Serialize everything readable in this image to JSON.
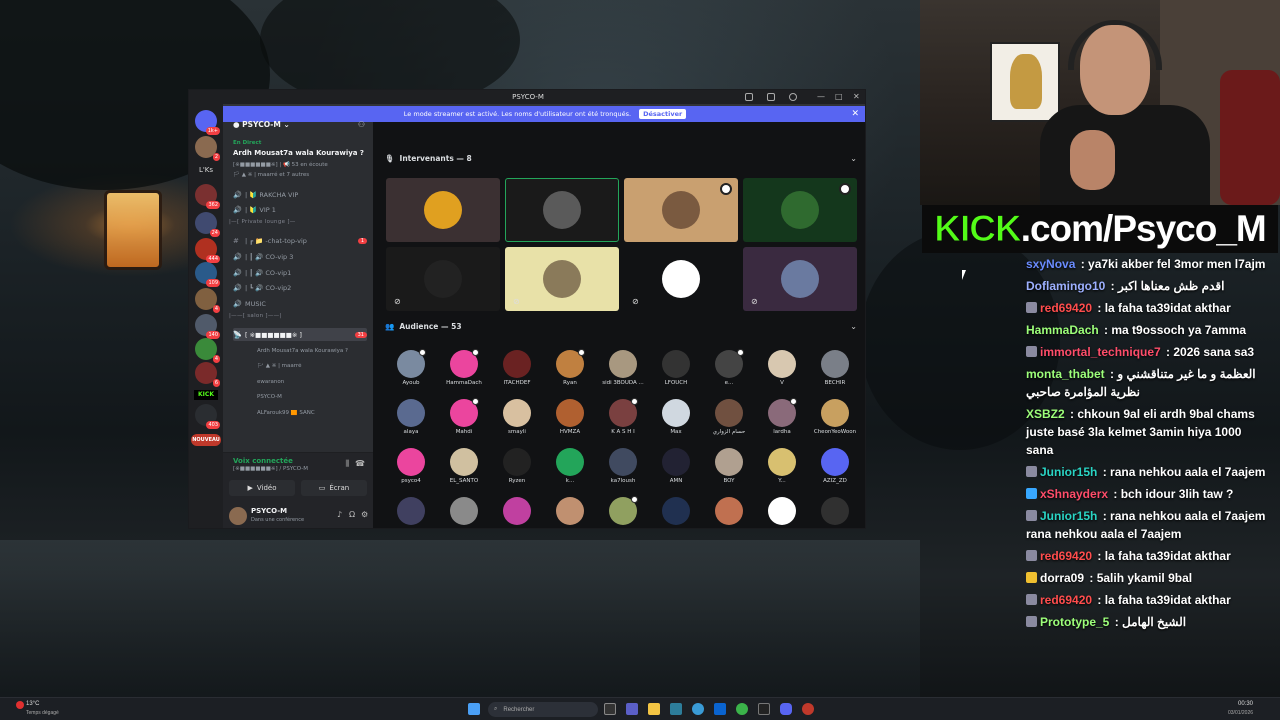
{
  "window": {
    "title": "PSYCO-M"
  },
  "streamer_banner": {
    "text": "Le mode streamer est activé. Les noms d'utilisateur ont été tronqués.",
    "button": "Désactiver"
  },
  "server": {
    "name": "PSYCO-M",
    "live_tag": "En Direct",
    "stage_title": "Ardh Mousat7a wala Kourawiya ?",
    "stage_sub": "[※■■■■■■※] | 📢 53 en écoute",
    "stage_sub2": "🏳 ▲ ※ | maarré et 7 autres"
  },
  "rail": {
    "l_ks": "L'Ks",
    "kick": "KICK",
    "nouveau": "NOUVEAU",
    "badges": [
      "1k+",
      "2",
      "362",
      "24",
      "444",
      "109",
      "4",
      "140",
      "4",
      "6",
      "403"
    ]
  },
  "channels": [
    {
      "icon": "🔊",
      "label": "| 🔰 RAKCHA VIP"
    },
    {
      "icon": "🔊",
      "label": "| 🔰 VIP 1"
    },
    {
      "icon": "cat",
      "label": "|—[ Private lounge ]—"
    },
    {
      "icon": "#",
      "label": "| ┏ 📁 -chat-top-vip",
      "badge": "1"
    },
    {
      "icon": "🔊",
      "label": "| ┃ 🔊 CO-vip 3"
    },
    {
      "icon": "🔊",
      "label": "| ┃ 🔊 CO-vip1"
    },
    {
      "icon": "🔊",
      "label": "| ┗ 🔊 CO-vip2"
    },
    {
      "icon": "🔊",
      "label": "MUSIC"
    },
    {
      "icon": "cat",
      "label": "|——[ salon ]——|"
    },
    {
      "icon": "📡",
      "label": "[ ※■■■■■■※ ]",
      "badge": "31"
    },
    {
      "icon": "",
      "label": "Ardh Mousat7a wala Kourawiya ?"
    },
    {
      "icon": "",
      "label": "🏳 ▲ ※ | maarré"
    },
    {
      "icon": "",
      "label": "ewaranon"
    },
    {
      "icon": "",
      "label": "PSYCO-M"
    },
    {
      "icon": "",
      "label": "ALFarouk99 🟧 SANC"
    }
  ],
  "voice": {
    "status": "Voix connectée",
    "path": "[※■■■■■■※] / PSYCO-M",
    "video": "Vidéo",
    "screen": "Écran"
  },
  "user": {
    "name": "PSYCO-M",
    "status": "Dans une conférence"
  },
  "stage": {
    "speakers_label": "Intervenants — 8",
    "audience_label": "Audience — 53",
    "speakers": [
      {
        "bg": "#3b3032",
        "av": "#e0a020"
      },
      {
        "bg": "#1a1a1a",
        "av": "#5a5a5a"
      },
      {
        "bg": "#c9a070",
        "av": "#7a5a40"
      },
      {
        "bg": "#14371c",
        "av": "#2f6a2f"
      },
      {
        "bg": "#1a1a1a",
        "av": "#222"
      },
      {
        "bg": "#e8e1a8",
        "av": "#8a7a5a"
      },
      {
        "bg": "#111214",
        "av": "#ffffff"
      },
      {
        "bg": "#3a2a40",
        "av": "#6a7aa0"
      }
    ],
    "audience": [
      {
        "name": "Ayoub",
        "c": "#7a8aa0"
      },
      {
        "name": "HammaDach",
        "c": "#eb459e"
      },
      {
        "name": "ITACHDEF",
        "c": "#6a2222"
      },
      {
        "name": "Ryan",
        "c": "#c08040"
      },
      {
        "name": "sidi 3BOUDA ...",
        "c": "#a89880"
      },
      {
        "name": "LFOUCH",
        "c": "#333"
      },
      {
        "name": "e...",
        "c": "#444"
      },
      {
        "name": "V",
        "c": "#d8c8b0"
      },
      {
        "name": "BECHIR",
        "c": "#7a7f88"
      },
      {
        "name": "alaya",
        "c": "#5a6a90"
      },
      {
        "name": "Mahdi",
        "c": "#eb459e"
      },
      {
        "name": "smayli",
        "c": "#d8c0a0"
      },
      {
        "name": "HVMZA",
        "c": "#b06030"
      },
      {
        "name": "K A S H I",
        "c": "#7a4040"
      },
      {
        "name": "Max",
        "c": "#d0d8e0"
      },
      {
        "name": "حسام الزواري",
        "c": "#705040"
      },
      {
        "name": "lardha",
        "c": "#8a6a7a"
      },
      {
        "name": "CheonYeoWoon",
        "c": "#c8a060"
      },
      {
        "name": "psyco4",
        "c": "#eb459e"
      },
      {
        "name": "EL_SANTO",
        "c": "#d0c0a0"
      },
      {
        "name": "Ryzen",
        "c": "#222"
      },
      {
        "name": "k...",
        "c": "#23a55a"
      },
      {
        "name": "ka7loush",
        "c": "#404a60"
      },
      {
        "name": "AMN",
        "c": "#223"
      },
      {
        "name": "BOY",
        "c": "#b0a090"
      },
      {
        "name": "Y...",
        "c": "#d8c070"
      },
      {
        "name": "AZIZ_ZD",
        "c": "#5865f2"
      },
      {
        "name": "",
        "c": "#404060"
      },
      {
        "name": "",
        "c": "#8a8a8a"
      },
      {
        "name": "",
        "c": "#c040a0"
      },
      {
        "name": "",
        "c": "#c09070"
      },
      {
        "name": "",
        "c": "#90a060"
      },
      {
        "name": "",
        "c": "#203050"
      },
      {
        "name": "",
        "c": "#c07050"
      },
      {
        "name": "",
        "c": "#ffffff"
      },
      {
        "name": "",
        "c": "#303030"
      }
    ]
  },
  "webcam": {
    "banner": "KICK.com/Psyco_M",
    "banner_k": "KICK"
  },
  "chat": [
    {
      "user": "sxyNova",
      "color": "#6a8cff",
      "text": " : ya7ki akber fel 3mor men l7ajm"
    },
    {
      "user": "Doflamingo10",
      "color": "#9db0ff",
      "text": " : اقدم ظش معناها اكبر"
    },
    {
      "user": "red69420",
      "color": "#ff4d4d",
      "text": " : la faha ta39idat akthar",
      "badge": "#8a8aa0"
    },
    {
      "user": "HammaDach",
      "color": "#9dff7a",
      "text": " : ma t9ossoch ya 7amma"
    },
    {
      "user": "immortal_technique7",
      "color": "#ff4d6a",
      "text": " : 2026 sana sa3",
      "badge": "#8a8aa0"
    },
    {
      "user": "monta_thabet",
      "color": "#9dff7a",
      "text": " : العظمة و ما غير متناقشني و نظرية المؤامرة صاحبي"
    },
    {
      "user": "XSBZ2",
      "color": "#9dff7a",
      "text": " : chkoun 9al eli ardh 9bal chams juste basé 3la kelmet 3amin hiya 1000 sana"
    },
    {
      "user": "Junior15h",
      "color": "#2ad4c4",
      "text": " : rana nehkou aala el 7aajem",
      "badge": "#8a8aa0"
    },
    {
      "user": "xShnayderx",
      "color": "#ff4d6a",
      "text": " : bch idour 3lih taw ?",
      "badge": "#38a8ff"
    },
    {
      "user": "Junior15h",
      "color": "#2ad4c4",
      "text": " : rana nehkou aala el 7aajem rana nehkou aala el 7aajem",
      "badge": "#8a8aa0"
    },
    {
      "user": "red69420",
      "color": "#ff4d4d",
      "text": " : la faha ta39idat akthar",
      "badge": "#8a8aa0"
    },
    {
      "user": "dorra09",
      "color": "#ffffff",
      "text": " : 5alih ykamil 9bal",
      "badge": "#f0c030"
    },
    {
      "user": "red69420",
      "color": "#ff4d4d",
      "text": " : la faha ta39idat akthar",
      "badge": "#8a8aa0"
    },
    {
      "user": "Prototype_5",
      "color": "#9dff7a",
      "text": " : الشيخ الهامل",
      "badge": "#8a8aa0"
    }
  ],
  "taskbar": {
    "temp": "13°C",
    "weather": "Temps dégagé",
    "search": "Rechercher",
    "time": "00:30",
    "date": "03/01/2026"
  }
}
